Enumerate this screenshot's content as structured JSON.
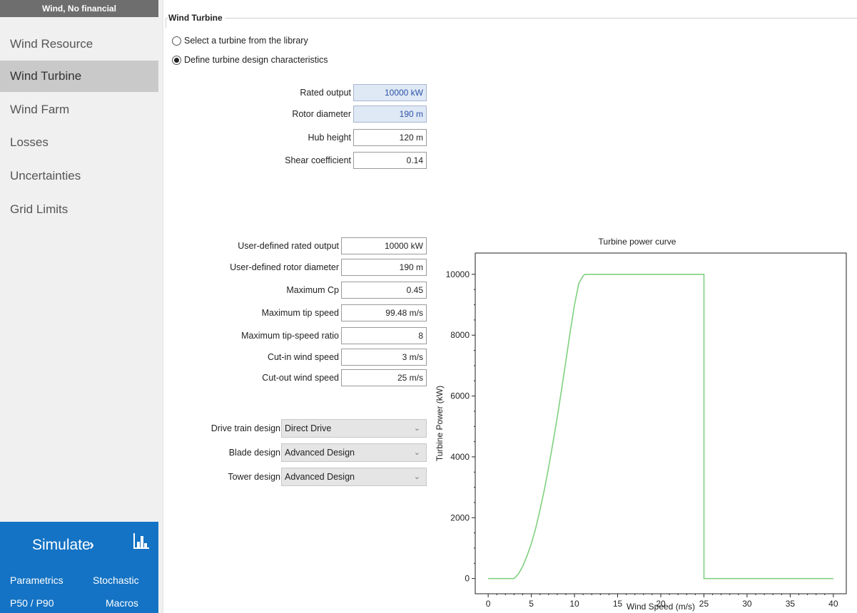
{
  "sidebar": {
    "config_title": "Wind, No financial",
    "items": [
      {
        "label": "Wind Resource",
        "active": false
      },
      {
        "label": "Wind Turbine",
        "active": true
      },
      {
        "label": "Wind Farm",
        "active": false
      },
      {
        "label": "Losses",
        "active": false
      },
      {
        "label": "Uncertainties",
        "active": false
      },
      {
        "label": "Grid Limits",
        "active": false
      }
    ],
    "simulate_label": "Simulate",
    "simulate_chevron": "›",
    "simulate_icon": "bar-chart-icon",
    "links": [
      "Parametrics",
      "Stochastic",
      "P50 / P90",
      "Macros"
    ],
    "accent_color": "#1473c4"
  },
  "main": {
    "group_title": "Wind Turbine",
    "radio_library": "Select a turbine from the library",
    "radio_define": "Define turbine design characteristics",
    "radio_selected": "define",
    "fields_top": [
      {
        "label": "Rated output",
        "value": "10000 kW",
        "highlighted": true
      },
      {
        "label": "Rotor diameter",
        "value": "190 m",
        "highlighted": true
      },
      {
        "label": "Hub height",
        "value": "120 m",
        "highlighted": false
      },
      {
        "label": "Shear coefficient",
        "value": "0.14",
        "highlighted": false
      }
    ],
    "fields_design": [
      {
        "label": "User-defined rated output",
        "value": "10000 kW"
      },
      {
        "label": "User-defined rotor diameter",
        "value": "190 m"
      },
      {
        "label": "Maximum Cp",
        "value": "0.45"
      },
      {
        "label": "Maximum tip speed",
        "value": "99.48 m/s"
      },
      {
        "label": "Maximum tip-speed ratio",
        "value": "8"
      },
      {
        "label": "Cut-in wind speed",
        "value": "3 m/s"
      },
      {
        "label": "Cut-out wind speed",
        "value": "25 m/s"
      }
    ],
    "selects": [
      {
        "label": "Drive train design",
        "value": "Direct Drive"
      },
      {
        "label": "Blade design",
        "value": "Advanced Design"
      },
      {
        "label": "Tower design",
        "value": "Advanced Design"
      }
    ]
  },
  "chart_data": {
    "type": "line",
    "title": "Turbine power curve",
    "xlabel": "Wind Speed (m/s)",
    "ylabel": "Turbine Power (kW)",
    "xlim": [
      -1.5,
      41.5
    ],
    "ylim": [
      -500,
      10700
    ],
    "xticks": [
      0,
      5,
      10,
      15,
      20,
      25,
      30,
      35,
      40
    ],
    "yticks": [
      0,
      2000,
      4000,
      6000,
      8000,
      10000
    ],
    "grid": false,
    "series": [
      {
        "color": "#7fd17f",
        "x": [
          0,
          3,
          3.5,
          4,
          4.5,
          5,
          5.5,
          6,
          6.5,
          7,
          7.5,
          8,
          8.5,
          9,
          9.5,
          10,
          10.5,
          11,
          11.2,
          25,
          25,
          40
        ],
        "y": [
          0,
          0,
          150,
          400,
          750,
          1150,
          1650,
          2250,
          2900,
          3650,
          4450,
          5300,
          6200,
          7150,
          8100,
          9000,
          9700,
          9950,
          10000,
          10000,
          0,
          0
        ]
      }
    ]
  }
}
